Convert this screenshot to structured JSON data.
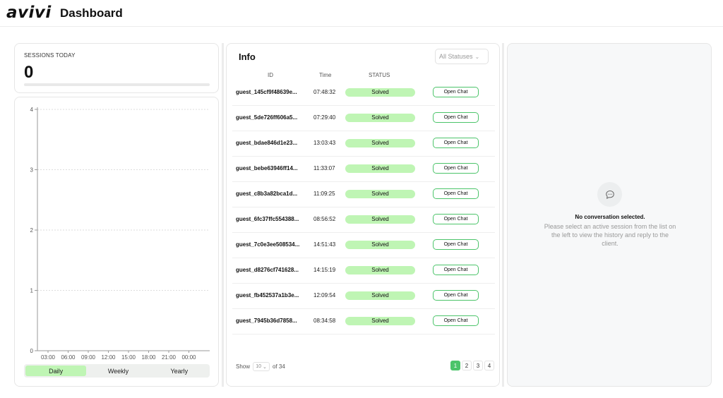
{
  "header": {
    "logo": "avivi",
    "title": "Dashboard"
  },
  "sessions": {
    "label": "SESSIONS TODAY",
    "count": "0",
    "progress": 0
  },
  "chart_data": {
    "type": "bar",
    "categories": [
      "03:00",
      "06:00",
      "09:00",
      "12:00",
      "15:00",
      "18:00",
      "21:00",
      "00:00"
    ],
    "values": [
      0,
      0,
      0,
      0,
      0,
      0,
      0,
      0
    ],
    "yticks": [
      "0",
      "1",
      "2",
      "3",
      "4"
    ],
    "ylim": [
      0,
      4
    ],
    "grid": true
  },
  "period_tabs": [
    {
      "label": "Daily",
      "active": true
    },
    {
      "label": "Weekly",
      "active": false
    },
    {
      "label": "Yearly",
      "active": false
    }
  ],
  "info": {
    "title": "Info",
    "status_filter": "All Statuses",
    "columns": {
      "id": "ID",
      "time": "Time",
      "status": "STATUS"
    },
    "rows": [
      {
        "id": "guest_145cf9f48639e...",
        "time": "07:48:32",
        "status": "Solved",
        "action": "Open Chat"
      },
      {
        "id": "guest_5de726ff606a5...",
        "time": "07:29:40",
        "status": "Solved",
        "action": "Open Chat"
      },
      {
        "id": "guest_bdae846d1e23...",
        "time": "13:03:43",
        "status": "Solved",
        "action": "Open Chat"
      },
      {
        "id": "guest_bebe63946ff14...",
        "time": "11:33:07",
        "status": "Solved",
        "action": "Open Chat"
      },
      {
        "id": "guest_c8b3a82bca1d...",
        "time": "11:09:25",
        "status": "Solved",
        "action": "Open Chat"
      },
      {
        "id": "guest_6fc37ffc554388...",
        "time": "08:56:52",
        "status": "Solved",
        "action": "Open Chat"
      },
      {
        "id": "guest_7c0e3ee508534...",
        "time": "14:51:43",
        "status": "Solved",
        "action": "Open Chat"
      },
      {
        "id": "guest_d8276cf741628...",
        "time": "14:15:19",
        "status": "Solved",
        "action": "Open Chat"
      },
      {
        "id": "guest_fb452537a1b3e...",
        "time": "12:09:54",
        "status": "Solved",
        "action": "Open Chat"
      },
      {
        "id": "guest_7945b36d7858...",
        "time": "08:34:58",
        "status": "Solved",
        "action": "Open Chat"
      }
    ],
    "show_label": "Show",
    "per_page": "10",
    "of_total": "of 34",
    "pages": [
      {
        "label": "1",
        "active": true
      },
      {
        "label": "2",
        "active": false
      },
      {
        "label": "3",
        "active": false
      },
      {
        "label": "4",
        "active": false
      }
    ]
  },
  "conversation": {
    "icon": "chat-bubble-icon",
    "title": "No conversation selected.",
    "message": "Please select an active session from the list on the left to view the history and reply to the client."
  },
  "colors": {
    "accent": "#4cc46a",
    "badge": "#bff5b4",
    "panel_bg": "#f7f8f9"
  }
}
